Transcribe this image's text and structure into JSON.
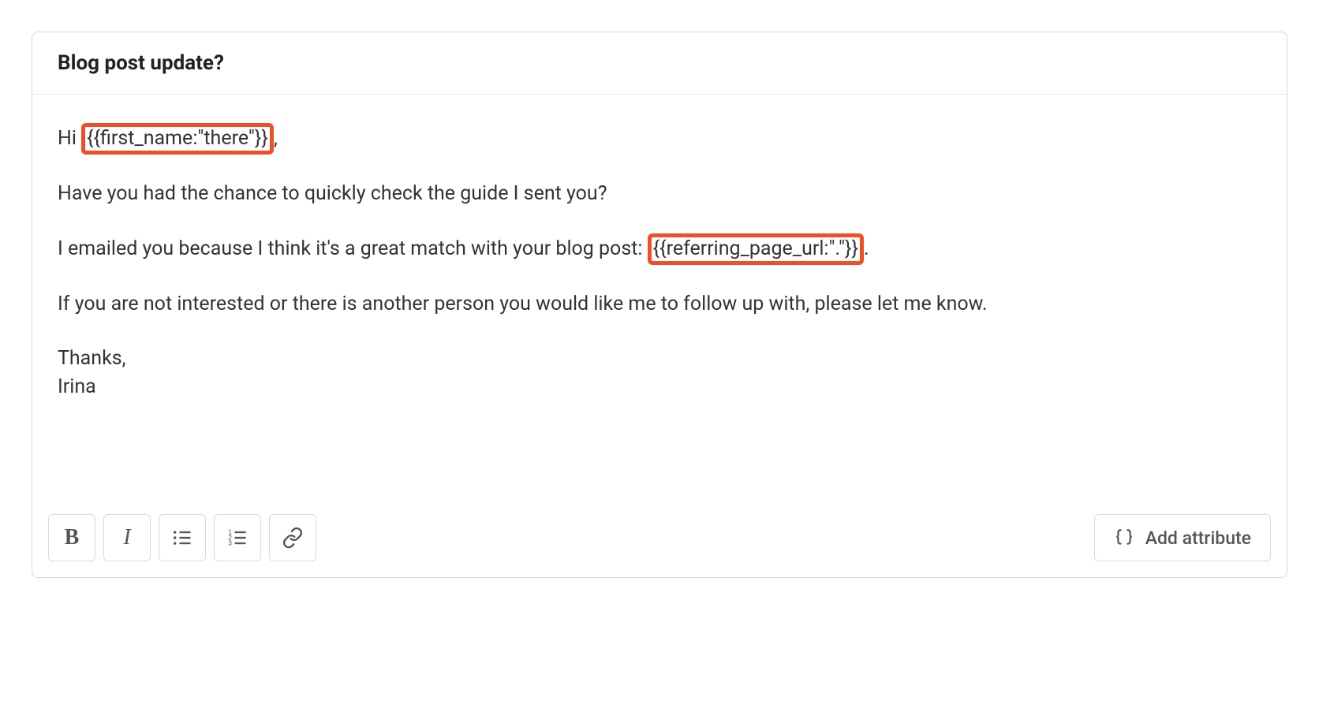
{
  "subject": "Blog post update?",
  "body": {
    "greeting_prefix": "Hi ",
    "greeting_token": "{{first_name:\"there\"}}",
    "greeting_suffix": ",",
    "line1": "Have you had the chance to quickly check the guide I sent you?",
    "line2_prefix": "I emailed you because I think it's a great match with your blog post: ",
    "line2_token": "{{referring_page_url:\".\"}}",
    "line2_suffix": ".",
    "line3": "If you are not interested or there is another person you would like me to follow up with, please let me know.",
    "signoff": "Thanks,",
    "signature": "Irina"
  },
  "toolbar": {
    "bold_glyph": "B",
    "italic_glyph": "I",
    "add_attribute_label": "Add attribute"
  }
}
